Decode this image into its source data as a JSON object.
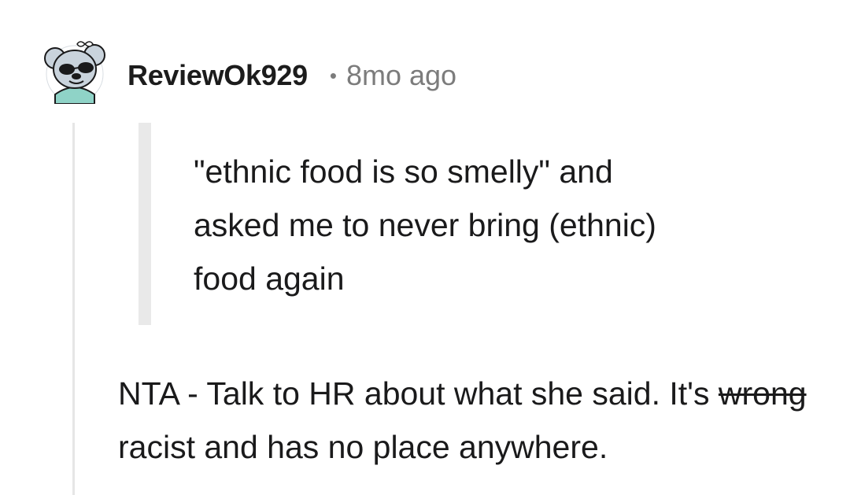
{
  "comment": {
    "username": "ReviewOk929",
    "separator": "•",
    "timestamp": "8mo ago",
    "quote_lines": [
      "\"ethnic food is so smelly\" and",
      "asked me to never bring (ethnic)",
      "food again"
    ],
    "body": {
      "prefix": "NTA - Talk to HR about what she said. It's ",
      "struck_word": "wrong",
      "suffix": " racist and has no place anywhere."
    }
  },
  "avatar": {
    "icon": "koala-sunglasses-snoovatar-icon",
    "colors": {
      "background": "#ffffff",
      "body": "#c9d3dc",
      "outline": "#1a1a1b",
      "shirt": "#8fd3c7"
    }
  },
  "colors": {
    "text": "#1a1a1b",
    "meta": "#7c7c7c",
    "thread_line": "#e6e6e6",
    "quote_bar": "#e9e9e9"
  }
}
